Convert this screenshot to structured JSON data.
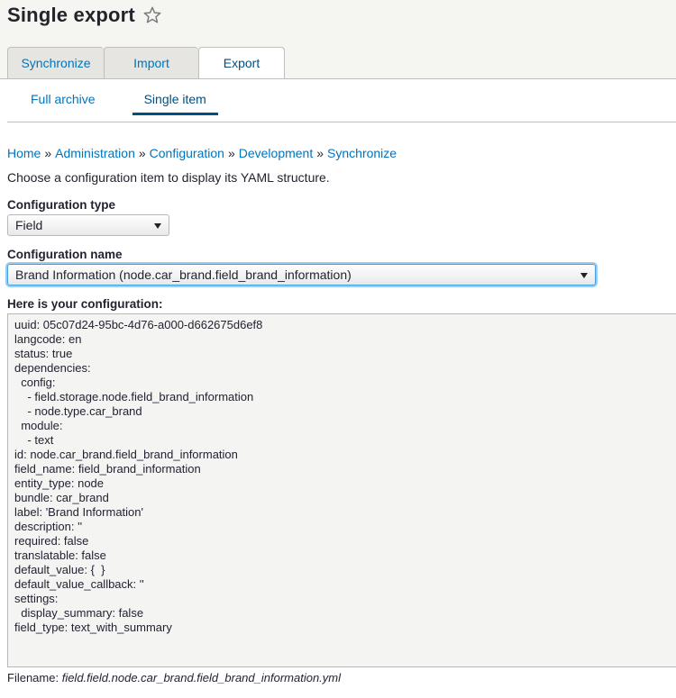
{
  "page": {
    "title": "Single export",
    "star_icon": "star-icon"
  },
  "primary_tabs": [
    {
      "label": "Synchronize",
      "active": false
    },
    {
      "label": "Import",
      "active": false
    },
    {
      "label": "Export",
      "active": true
    }
  ],
  "secondary_tabs": [
    {
      "label": "Full archive",
      "active": false
    },
    {
      "label": "Single item",
      "active": true
    }
  ],
  "breadcrumb": [
    "Home",
    "Administration",
    "Configuration",
    "Development",
    "Synchronize"
  ],
  "breadcrumb_separator": "»",
  "intro": "Choose a configuration item to display its YAML structure.",
  "form": {
    "config_type_label": "Configuration type",
    "config_type_value": "Field",
    "config_name_label": "Configuration name",
    "config_name_value": "Brand Information (node.car_brand.field_brand_information)",
    "output_label": "Here is your configuration:"
  },
  "yaml_lines": [
    "uuid: 05c07d24-95bc-4d76-a000-d662675d6ef8",
    "langcode: en",
    "status: true",
    "dependencies:",
    "  config:",
    "    - field.storage.node.field_brand_information",
    "    - node.type.car_brand",
    "  module:",
    "    - text",
    "id: node.car_brand.field_brand_information",
    "field_name: field_brand_information",
    "entity_type: node",
    "bundle: car_brand",
    "label: 'Brand Information'",
    "description: ''",
    "required: false",
    "translatable: false",
    "default_value: {  }",
    "default_value_callback: ''",
    "settings:",
    "  display_summary: false",
    "field_type: text_with_summary"
  ],
  "filename": {
    "label": "Filename:",
    "value": "field.field.node.car_brand.field_brand_information.yml"
  },
  "colors": {
    "link": "#0074bd",
    "active_tab": "#004f80",
    "header_bg": "#f5f5f2",
    "focus": "#40a0e0"
  }
}
